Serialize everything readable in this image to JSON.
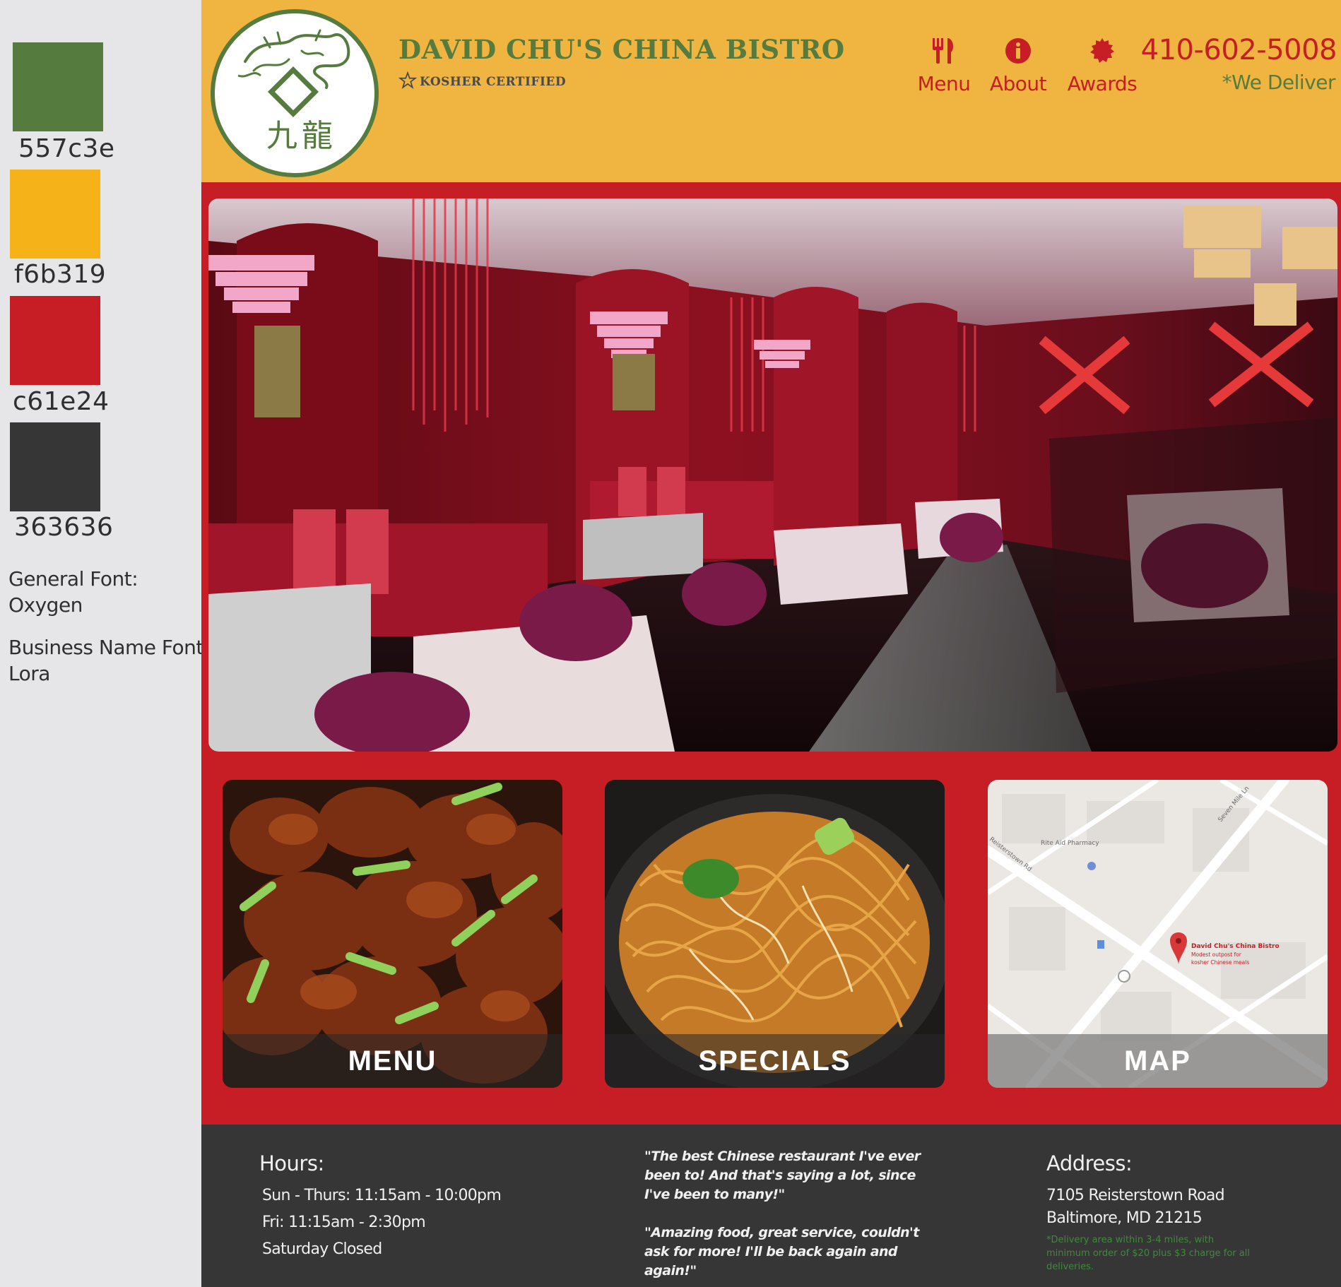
{
  "style_guide": {
    "swatches": [
      {
        "hex": "557c3e",
        "color": "#557c3e"
      },
      {
        "hex": "f6b319",
        "color": "#f6b319"
      },
      {
        "hex": "c61e24",
        "color": "#c61e24"
      },
      {
        "hex": "363636",
        "color": "#363636"
      }
    ],
    "general_font_label": "General Font:",
    "general_font_value": "Oxygen",
    "business_font_label": "Business Name Font:",
    "business_font_value": "Lora"
  },
  "header": {
    "business_name": "DAVID CHU'S CHINA BISTRO",
    "kosher": "KOSHER CERTIFIED",
    "nav": [
      {
        "label": "Menu",
        "icon": "fork-knife-icon"
      },
      {
        "label": "About",
        "icon": "info-icon"
      },
      {
        "label": "Awards",
        "icon": "award-seal-icon"
      }
    ],
    "phone": "410-602-5008",
    "delivery": "*We Deliver"
  },
  "tiles": [
    {
      "label": "MENU",
      "image": "general-tso-chicken-photo"
    },
    {
      "label": "SPECIALS",
      "image": "lo-mein-noodles-photo"
    },
    {
      "label": "MAP",
      "image": "google-map-thumbnail"
    }
  ],
  "map": {
    "pin_name": "David Chu's China Bistro",
    "pin_sub1": "Modest outpost for",
    "pin_sub2": "kosher Chinese meals",
    "poi": "Rite Aid Pharmacy",
    "road1": "Reisterstown Rd",
    "road2": "Seven Mile Ln"
  },
  "footer": {
    "hours_title": "Hours:",
    "hours": [
      "Sun - Thurs:  11:15am - 10:00pm",
      "Fri:  11:15am - 2:30pm",
      "Saturday  Closed"
    ],
    "quote1": "\"The best Chinese restaurant I've ever been to! And that's saying a lot, since I've been to many!\"",
    "quote2": "\"Amazing food, great service, couldn't ask for more! I'll be back again and again!\"",
    "address_title": "Address:",
    "address_line1": "7105 Reisterstown Road",
    "address_line2": "Baltimore, MD 21215",
    "delivery_note": "*Delivery area within 3-4 miles, with minimum order of $20 plus $3 charge for all deliveries."
  }
}
